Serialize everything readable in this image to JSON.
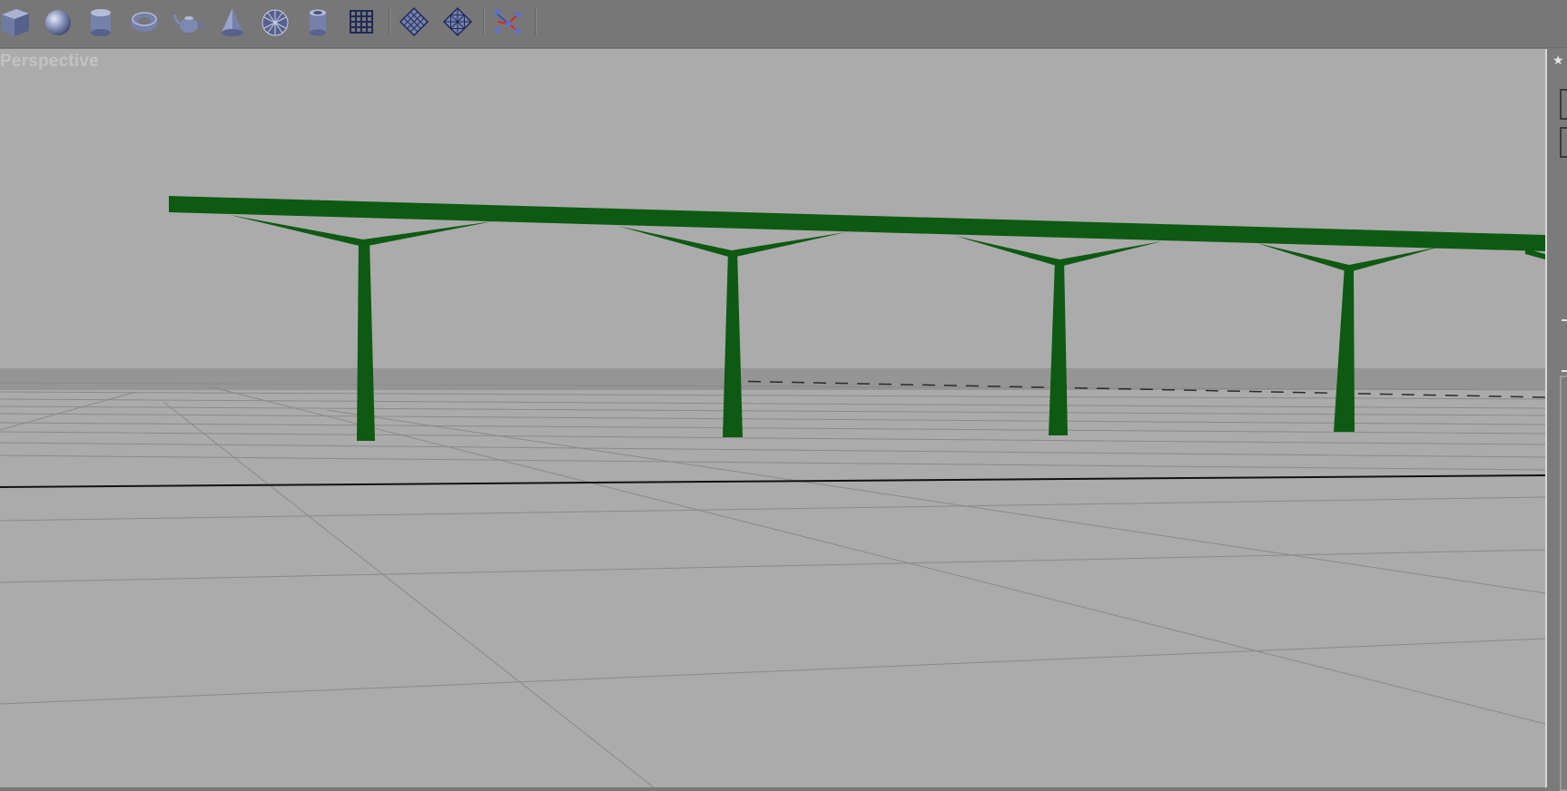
{
  "window": {
    "viewport_label": "Perspective"
  },
  "toolbar": {
    "groups": [
      [
        "box-icon",
        "sphere-icon",
        "cylinder-icon",
        "torus-icon",
        "teapot-icon",
        "cone-icon",
        "geosphere-icon",
        "tube-icon",
        "plane-grid-icon"
      ],
      [
        "patch-quad-icon",
        "patch-tri-icon"
      ],
      [
        "particle-icon"
      ]
    ]
  },
  "colors": {
    "toolbar_bg": "#777777",
    "viewport_bg": "#ababab",
    "model_green": "#0e5a12",
    "icon_blue": "#8793b8",
    "grid_line": "#8a8a8a",
    "grid_axis": "#111111"
  }
}
